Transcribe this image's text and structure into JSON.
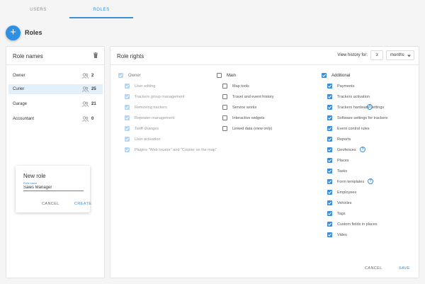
{
  "tabs": [
    {
      "label": "USERS"
    },
    {
      "label": "ROLES"
    }
  ],
  "header": {
    "add_icon": "+",
    "title": "Roles"
  },
  "role_names": {
    "title": "Role names",
    "delete_icon": "trash-icon",
    "roles": [
      {
        "name": "Owner",
        "count": "2"
      },
      {
        "name": "Curier",
        "count": "25"
      },
      {
        "name": "Garage",
        "count": "21"
      },
      {
        "name": "Accountant",
        "count": "0"
      }
    ]
  },
  "new_role": {
    "title": "New role",
    "field_label": "Role name",
    "field_value": "Sales Manager",
    "cancel": "CANCEL",
    "create": "CREATE"
  },
  "role_rights": {
    "title": "Role rights",
    "history_label": "View history for:",
    "history_value": "3",
    "history_unit": "months",
    "colors": {
      "accent": "#3b8fd8",
      "accent_dim": "#b6d4ee"
    },
    "groups": {
      "owner": {
        "label": "Owner",
        "items": [
          "User editing",
          "Trackers group management",
          "Removing trackers",
          "Repeater management",
          "Tariff changes",
          "User activation",
          "Plugins \"Web locator\" and \"Courier on the map\""
        ]
      },
      "main": {
        "label": "Main",
        "items": [
          "Map tools",
          "Travel and event history",
          "Service works",
          "Interactive widgets",
          "Linked data (view only)"
        ]
      },
      "additional": {
        "label": "Additional",
        "items": [
          "Payments",
          "Trackers activation",
          "Trackers hardware settings",
          "Software settings for trackers",
          "Event control rules",
          "Reports",
          "Geofences",
          "Places",
          "Tasks",
          "Form templates",
          "Employees",
          "Vehicles",
          "Tags",
          "Custom fields in places",
          "Video"
        ]
      }
    },
    "help_icon": "?",
    "cancel": "CANCEL",
    "save": "SAVE"
  }
}
